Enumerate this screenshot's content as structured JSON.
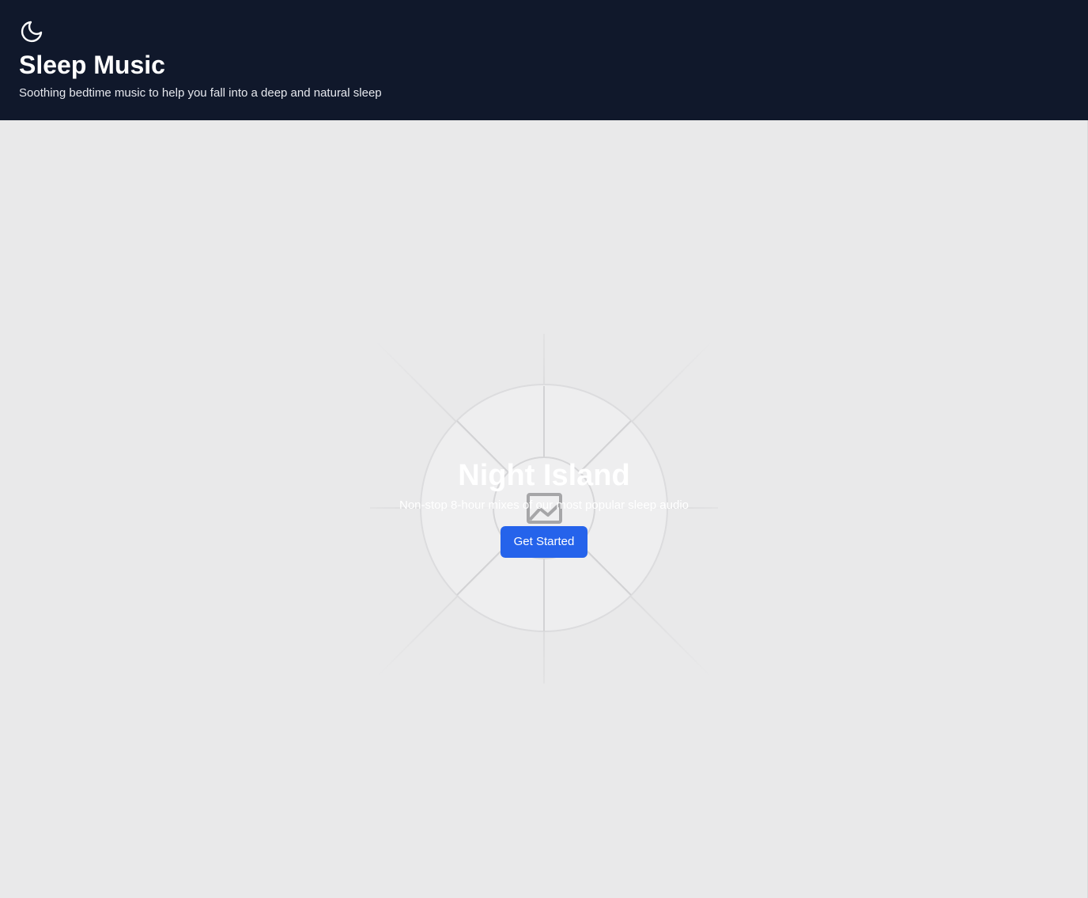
{
  "header": {
    "icon": "moon-icon",
    "title": "Sleep Music",
    "subtitle": "Soothing bedtime music to help you fall into a deep and natural sleep"
  },
  "hero": {
    "image_icon": "image-placeholder-icon",
    "title": "Night Island",
    "subtitle": "Non-stop 8-hour mixes of our most popular sleep audio",
    "cta_label": "Get Started"
  },
  "colors": {
    "header_bg": "#10182b",
    "hero_bg": "#e9e9ea",
    "accent": "#2563eb"
  }
}
